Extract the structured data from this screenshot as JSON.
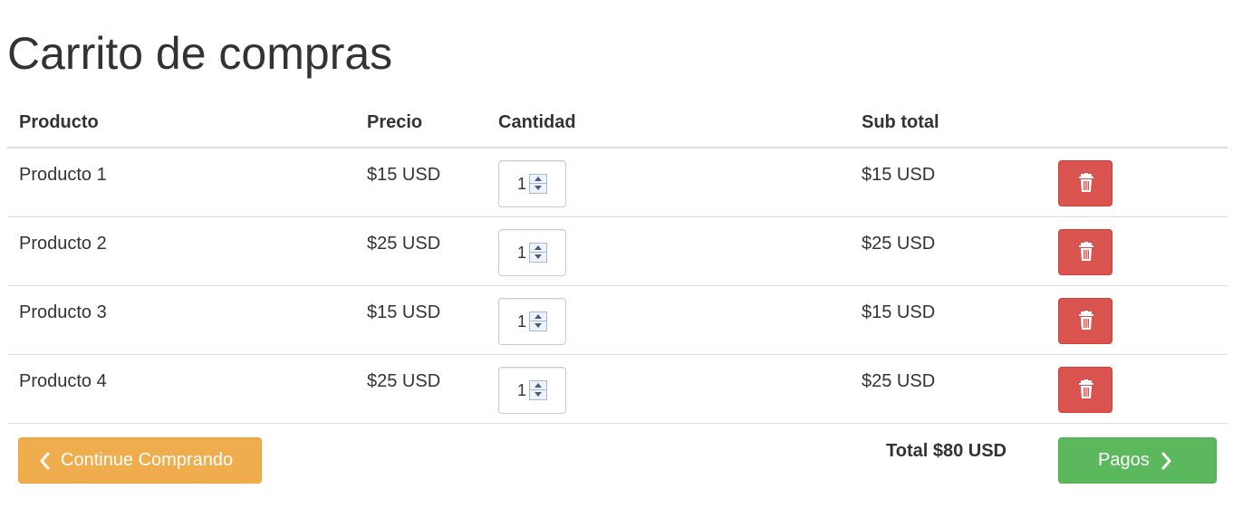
{
  "page": {
    "title": "Carrito de compras"
  },
  "table": {
    "headers": {
      "product": "Producto",
      "price": "Precio",
      "quantity": "Cantidad",
      "subtotal": "Sub total"
    },
    "rows": [
      {
        "product": "Producto 1",
        "price": "$15 USD",
        "quantity": "1",
        "subtotal": "$15 USD"
      },
      {
        "product": "Producto 2",
        "price": "$25 USD",
        "quantity": "1",
        "subtotal": "$25 USD"
      },
      {
        "product": "Producto 3",
        "price": "$15 USD",
        "quantity": "1",
        "subtotal": "$15 USD"
      },
      {
        "product": "Producto 4",
        "price": "$25 USD",
        "quantity": "1",
        "subtotal": "$25 USD"
      }
    ],
    "delete_icon": "trash-icon"
  },
  "footer": {
    "continue_label": "Continue Comprando",
    "continue_icon": "chevron-left-icon",
    "total": "Total $80 USD",
    "checkout_label": "Pagos",
    "checkout_icon": "chevron-right-icon"
  },
  "colors": {
    "danger": "#d9534f",
    "warning": "#f0ad4e",
    "success": "#5cb85c",
    "text": "#333333"
  }
}
